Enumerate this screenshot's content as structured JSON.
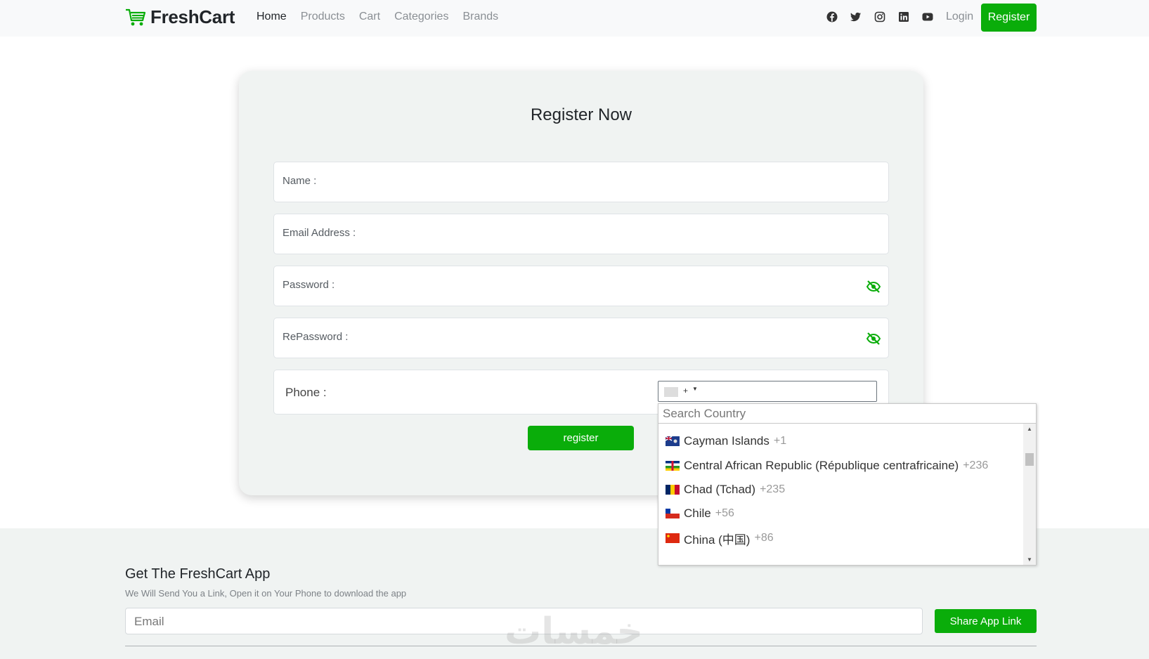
{
  "navbar": {
    "brand": "FreshCart",
    "links": [
      {
        "label": "Home",
        "active": true
      },
      {
        "label": "Products",
        "active": false
      },
      {
        "label": "Cart",
        "active": false
      },
      {
        "label": "Categories",
        "active": false
      },
      {
        "label": "Brands",
        "active": false
      }
    ],
    "social_icons": [
      "facebook-icon",
      "twitter-icon",
      "instagram-icon",
      "linkedin-icon",
      "youtube-icon"
    ],
    "login": "Login",
    "register": "Register"
  },
  "form": {
    "title": "Register Now",
    "name_label": "Name :",
    "email_label": "Email Address :",
    "password_label": "Password :",
    "repassword_label": "RePassword :",
    "phone_label": "Phone :",
    "phone_prefix": "+",
    "submit": "register"
  },
  "country_dropdown": {
    "search_placeholder": "Search Country",
    "countries": [
      {
        "name": "Cayman Islands",
        "code": "+1"
      },
      {
        "name": "Central African Republic (République centrafricaine)",
        "code": "+236"
      },
      {
        "name": "Chad (Tchad)",
        "code": "+235"
      },
      {
        "name": "Chile",
        "code": "+56"
      },
      {
        "name": "China (中国)",
        "code": "+86"
      }
    ]
  },
  "footer": {
    "title": "Get The FreshCart App",
    "subtitle": "We Will Send You a Link, Open it on Your Phone to download the app",
    "email_placeholder": "Email",
    "share_button": "Share App Link",
    "watermark": "خمسات"
  },
  "colors": {
    "accent": "#0aad0a",
    "card_bg": "#f0f3f2"
  }
}
